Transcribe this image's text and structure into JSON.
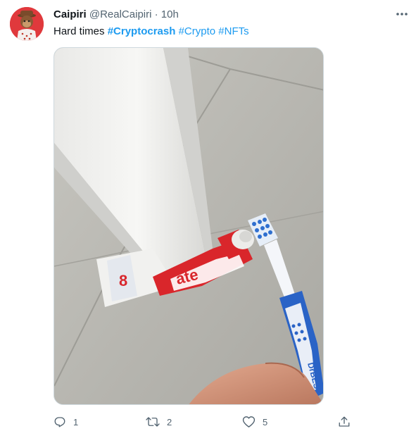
{
  "tweet": {
    "author_name": "Caipiri",
    "author_handle": "@RealCaipiri",
    "separator": "·",
    "timestamp": "10h",
    "text_plain": "Hard times ",
    "hashtags": [
      "#Cryptocrash",
      "#Crypto",
      "#NFTs"
    ],
    "media_icon": "photo-of-toothbrush-squeezing-toothpaste-under-door",
    "tube_brand_text": "ate",
    "toothbrush_brand_text": "DrBEST"
  },
  "actions": {
    "reply_count": "1",
    "retweet_count": "2",
    "like_count": "5"
  },
  "colors": {
    "accent": "#1d9bf0",
    "secondary_text": "#536471",
    "avatar_bg": "#e0393c"
  }
}
